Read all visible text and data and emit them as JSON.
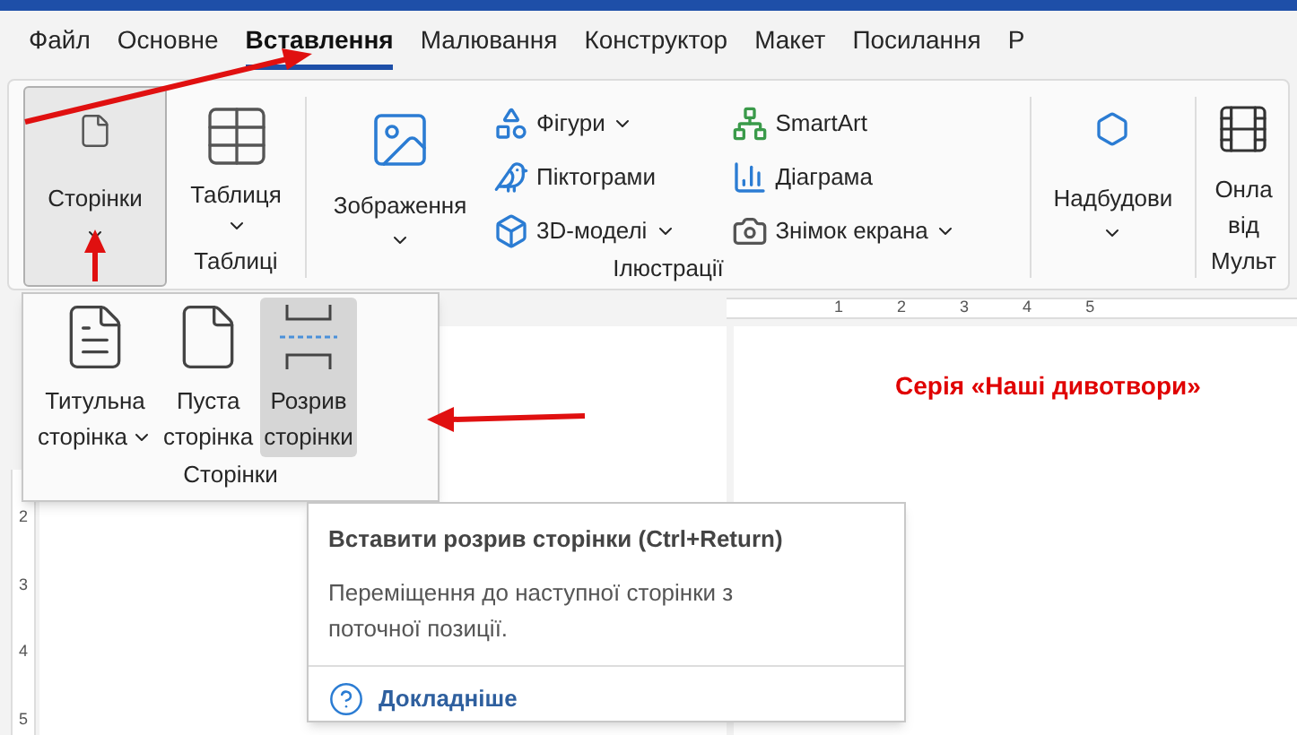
{
  "tabs": [
    {
      "label": "Файл",
      "selected": false
    },
    {
      "label": "Основне",
      "selected": false
    },
    {
      "label": "Вставлення",
      "selected": true
    },
    {
      "label": "Малювання",
      "selected": false
    },
    {
      "label": "Конструктор",
      "selected": false
    },
    {
      "label": "Макет",
      "selected": false
    },
    {
      "label": "Посилання",
      "selected": false
    },
    {
      "label": "Р",
      "selected": false
    }
  ],
  "ribbon": {
    "pages": {
      "label": "Сторінки",
      "selected": true
    },
    "tables": {
      "button": "Таблиця",
      "group_label": "Таблиці"
    },
    "illustrations": {
      "picture": "Зображення",
      "group_label": "Ілюстрації",
      "items": [
        {
          "label": "Фігури",
          "kind": "shapes",
          "dropdown": true
        },
        {
          "label": "Піктограми",
          "kind": "icons",
          "dropdown": false
        },
        {
          "label": "3D-моделі",
          "kind": "models",
          "dropdown": true
        },
        {
          "label": "SmartArt",
          "kind": "smartart",
          "dropdown": false
        },
        {
          "label": "Діаграма",
          "kind": "chart",
          "dropdown": false
        },
        {
          "label": "Знімок екрана",
          "kind": "screenshot",
          "dropdown": true
        }
      ]
    },
    "addins": {
      "label": "Надбудови"
    },
    "media": {
      "line_1": "Онла",
      "line_2": "від",
      "group_label": "Мульт"
    }
  },
  "pages_menu": {
    "group_label": "Сторінки",
    "items": [
      {
        "lines": [
          "Титульна",
          "сторінка"
        ],
        "kind": "cover",
        "dropdown": true,
        "selected": false
      },
      {
        "lines": [
          "Пуста",
          "сторінка"
        ],
        "kind": "blank",
        "dropdown": false,
        "selected": false
      },
      {
        "lines": [
          "Розрив",
          "сторінки"
        ],
        "kind": "break",
        "dropdown": false,
        "selected": true
      }
    ]
  },
  "ruler": {
    "numbers": [
      "1",
      "2",
      "3",
      "4",
      "5"
    ],
    "vertical_numbers": [
      "2",
      "3",
      "4",
      "5"
    ]
  },
  "document": {
    "heading": "Серія «Наші дивотвори»"
  },
  "tooltip": {
    "title": "Вставити розрив сторінки (Ctrl+Return)",
    "description": "Переміщення до наступної сторінки з поточної позиції.",
    "link": "Докладніше"
  }
}
